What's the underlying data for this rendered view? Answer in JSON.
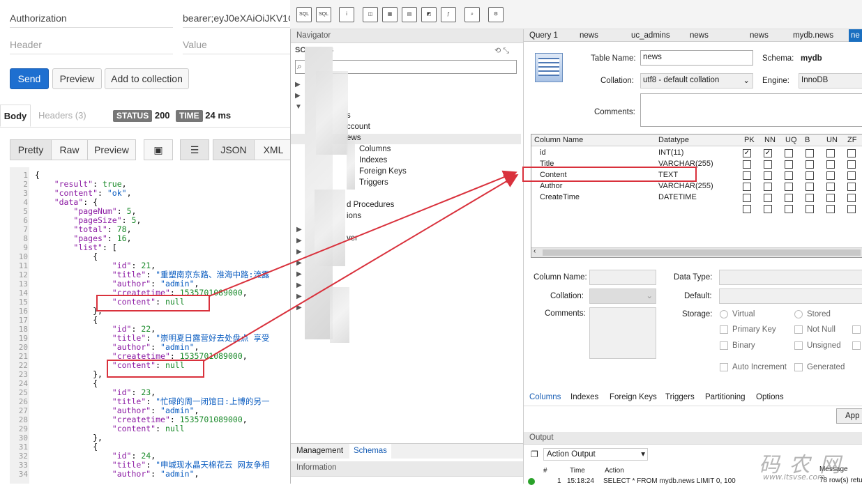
{
  "postman": {
    "headers": [
      {
        "key": "Authorization",
        "value": "bearer;eyJ0eXAiOiJKV1C"
      }
    ],
    "header_placeholder": "Header",
    "value_placeholder": "Value",
    "send_label": "Send",
    "preview_label": "Preview",
    "add_collection_label": "Add to collection",
    "tabs": {
      "body": "Body",
      "headers": "Headers (3)"
    },
    "status_label": "STATUS",
    "status_value": "200",
    "time_label": "TIME",
    "time_value": "24 ms",
    "view_modes": {
      "pretty": "Pretty",
      "raw": "Raw",
      "preview": "Preview",
      "json": "JSON",
      "xml": "XML"
    },
    "line_numbers": [
      "1",
      "2",
      "3",
      "4",
      "5",
      "6",
      "7",
      "8",
      "9",
      "10",
      "11",
      "12",
      "13",
      "14",
      "15",
      "16",
      "17",
      "18",
      "19",
      "20",
      "21",
      "22",
      "23",
      "24",
      "25",
      "26",
      "27",
      "28",
      "29",
      "30",
      "31",
      "32",
      "33",
      "34"
    ],
    "code_lines": [
      "{",
      "    \"result\": true,",
      "    \"content\": \"ok\",",
      "    \"data\": {",
      "        \"pageNum\": 5,",
      "        \"pageSize\": 5,",
      "        \"total\": 78,",
      "        \"pages\": 16,",
      "        \"list\": [",
      "            {",
      "                \"id\": 21,",
      "                \"title\": \"重塑南京东路、淮海中路:流露",
      "                \"author\": \"admin\",",
      "                \"createtime\": 1535701089000,",
      "                \"content\": null",
      "            },",
      "            {",
      "                \"id\": 22,",
      "                \"title\": \"崇明夏日露营好去处盘点 享受",
      "                \"author\": \"admin\",",
      "                \"createtime\": 1535701089000,",
      "                \"content\": null",
      "            },",
      "            {",
      "                \"id\": 23,",
      "                \"title\": \"忙碌的周一闭馆日:上博的另一",
      "                \"author\": \"admin\",",
      "                \"createtime\": 1535701089000,",
      "                \"content\": null",
      "            },",
      "            {",
      "                \"id\": 24,",
      "                \"title\": \"申城现水晶天棉花云 网友争相",
      "                \"author\": \"admin\","
    ]
  },
  "navigator": {
    "title": "Navigator",
    "schemas_label": "SCHEMAS",
    "items": [
      {
        "label": "s"
      },
      {
        "label": "ccount"
      },
      {
        "label": "ews"
      },
      {
        "label": "Columns"
      },
      {
        "label": "Indexes"
      },
      {
        "label": "Foreign Keys"
      },
      {
        "label": "Triggers"
      },
      {
        "label": "d Procedures"
      },
      {
        "label": "ions"
      },
      {
        "label": "ver"
      }
    ],
    "bottom_tabs": {
      "management": "Management",
      "schemas": "Schemas"
    },
    "information_label": "Information"
  },
  "editor": {
    "tabs": [
      "Query 1",
      "news",
      "uc_admins",
      "news",
      "news",
      "mydb.news",
      "ne"
    ],
    "table_name_label": "Table Name:",
    "table_name": "news",
    "schema_label": "Schema:",
    "schema": "mydb",
    "collation_label": "Collation:",
    "collation": "utf8 - default collation",
    "engine_label": "Engine:",
    "engine": "InnoDB",
    "comments_label": "Comments:",
    "grid_headers": [
      "Column Name",
      "Datatype",
      "PK",
      "NN",
      "UQ",
      "B",
      "UN",
      "ZF"
    ],
    "columns": [
      {
        "name": "id",
        "type": "INT(11)",
        "pk": true,
        "nn": true
      },
      {
        "name": "Title",
        "type": "VARCHAR(255)",
        "pk": false,
        "nn": false
      },
      {
        "name": "Content",
        "type": "TEXT",
        "pk": false,
        "nn": false
      },
      {
        "name": "Author",
        "type": "VARCHAR(255)",
        "pk": false,
        "nn": false
      },
      {
        "name": "CreateTime",
        "type": "DATETIME",
        "pk": false,
        "nn": false
      },
      {
        "name": "",
        "type": "",
        "pk": false,
        "nn": false
      }
    ],
    "detail": {
      "column_name_label": "Column Name:",
      "collation_label": "Collation:",
      "comments_label": "Comments:",
      "data_type_label": "Data Type:",
      "default_label": "Default:",
      "storage_label": "Storage:",
      "virtual": "Virtual",
      "stored": "Stored",
      "primary_key": "Primary Key",
      "not_null": "Not Null",
      "binary": "Binary",
      "unsigned": "Unsigned",
      "auto_increment": "Auto Increment",
      "generated": "Generated"
    },
    "bottom_tabs": [
      "Columns",
      "Indexes",
      "Foreign Keys",
      "Triggers",
      "Partitioning",
      "Options"
    ],
    "apply_label": "App",
    "output_label": "Output",
    "action_output_label": "Action Output",
    "output_headers": {
      "num": "#",
      "time": "Time",
      "action": "Action",
      "message": "Message"
    },
    "output_row": {
      "num": "1",
      "time": "15:18:24",
      "action": "SELECT * FROM mydb.news LIMIT 0, 100",
      "message": "78 row(s) retu"
    }
  },
  "watermark": {
    "text": "码 农 网",
    "url": "www.itsvse.com"
  }
}
